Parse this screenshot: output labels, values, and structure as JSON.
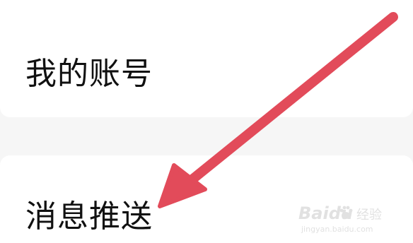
{
  "settings": {
    "items": [
      {
        "label": "我的账号"
      },
      {
        "label": "消息推送"
      }
    ]
  },
  "annotation": {
    "arrow_color": "#e24b5a",
    "arrow_target": "消息推送"
  },
  "watermark": {
    "brand_text": "Baidu",
    "jingyan_text": "经验",
    "url": "jingyan.baidu.com"
  },
  "colors": {
    "background": "#f6f6f6",
    "card": "#ffffff",
    "text": "#111111"
  }
}
